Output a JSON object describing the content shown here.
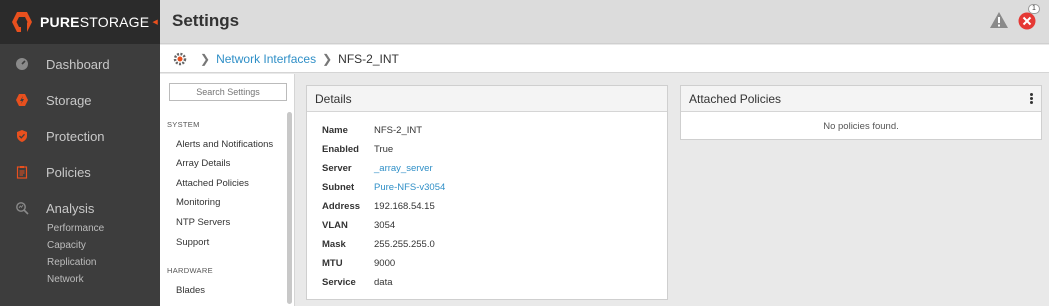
{
  "brand": {
    "name_bold": "PURE",
    "name_rest": "STORAGE",
    "accent": "#e8501e"
  },
  "nav": {
    "items": [
      {
        "label": "Dashboard",
        "icon": "dashboard-gauge-icon"
      },
      {
        "label": "Storage",
        "icon": "storage-bolt-icon"
      },
      {
        "label": "Protection",
        "icon": "shield-check-icon"
      },
      {
        "label": "Policies",
        "icon": "clipboard-icon"
      },
      {
        "label": "Analysis",
        "icon": "magnify-chart-icon"
      }
    ],
    "analysis_sub": [
      "Performance",
      "Capacity",
      "Replication",
      "Network"
    ]
  },
  "header": {
    "title": "Settings",
    "alert_count": "1"
  },
  "breadcrumb": {
    "link": "Network Interfaces",
    "current": "NFS-2_INT"
  },
  "settings": {
    "search_placeholder": "Search Settings",
    "section_system": "SYSTEM",
    "system_items": [
      "Alerts and Notifications",
      "Array Details",
      "Attached Policies",
      "Monitoring",
      "NTP Servers",
      "Support"
    ],
    "section_hardware": "HARDWARE",
    "hardware_items": [
      "Blades"
    ]
  },
  "details": {
    "title": "Details",
    "rows": [
      {
        "label": "Name",
        "value": "NFS-2_INT",
        "link": false
      },
      {
        "label": "Enabled",
        "value": "True",
        "link": false
      },
      {
        "label": "Server",
        "value": "_array_server",
        "link": true
      },
      {
        "label": "Subnet",
        "value": "Pure-NFS-v3054",
        "link": true
      },
      {
        "label": "Address",
        "value": "192.168.54.15",
        "link": false
      },
      {
        "label": "VLAN",
        "value": "3054",
        "link": false
      },
      {
        "label": "Mask",
        "value": "255.255.255.0",
        "link": false
      },
      {
        "label": "MTU",
        "value": "9000",
        "link": false
      },
      {
        "label": "Service",
        "value": "data",
        "link": false
      }
    ]
  },
  "policies": {
    "title": "Attached Policies",
    "empty_text": "No policies found."
  },
  "colors": {
    "link": "#2f8fc7",
    "sidebar_bg": "#3d3d3d",
    "alert_red": "#e53935",
    "warn_gray": "#8a8a8a"
  }
}
